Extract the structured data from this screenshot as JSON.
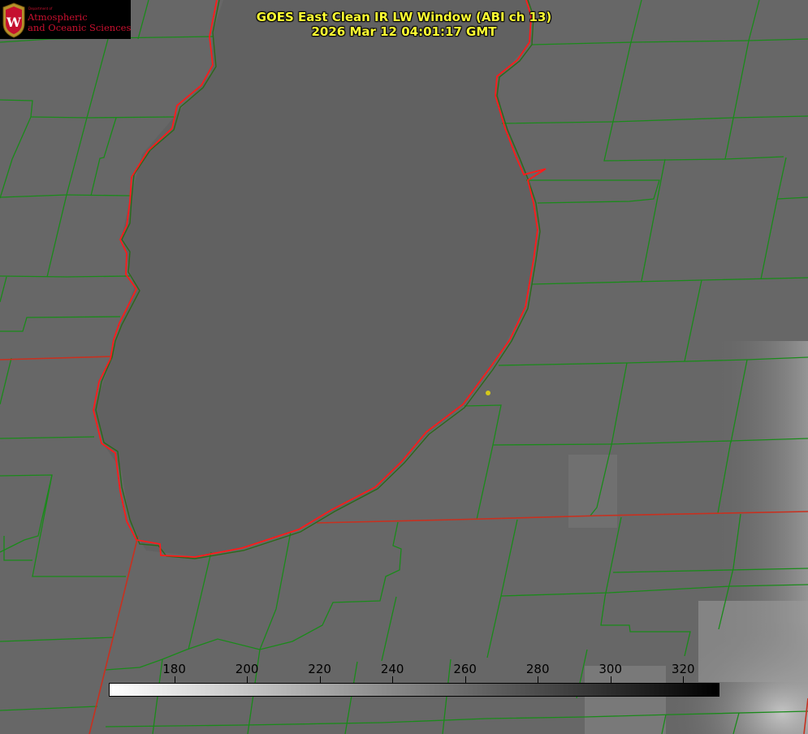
{
  "title": {
    "line1": "GOES East Clean IR LW Window (ABI ch 13)",
    "line2": "2026 Mar 12 04:01:17 GMT"
  },
  "logo": {
    "dept_small": "Department of",
    "line1": "Atmospheric",
    "line2": "and Oceanic Sciences",
    "icon": "uw-crest-icon"
  },
  "colorbar": {
    "min": 162,
    "max": 330,
    "ticks": [
      "180",
      "200",
      "220",
      "240",
      "260",
      "280",
      "300",
      "320"
    ],
    "gradient": [
      "#ffffff",
      "#000000"
    ]
  },
  "colors": {
    "background": "#676767",
    "county_lines": "#1a8a1a",
    "state_lines": "#c8301f",
    "coastline": "#ff1a1a",
    "title": "#ffff33"
  }
}
